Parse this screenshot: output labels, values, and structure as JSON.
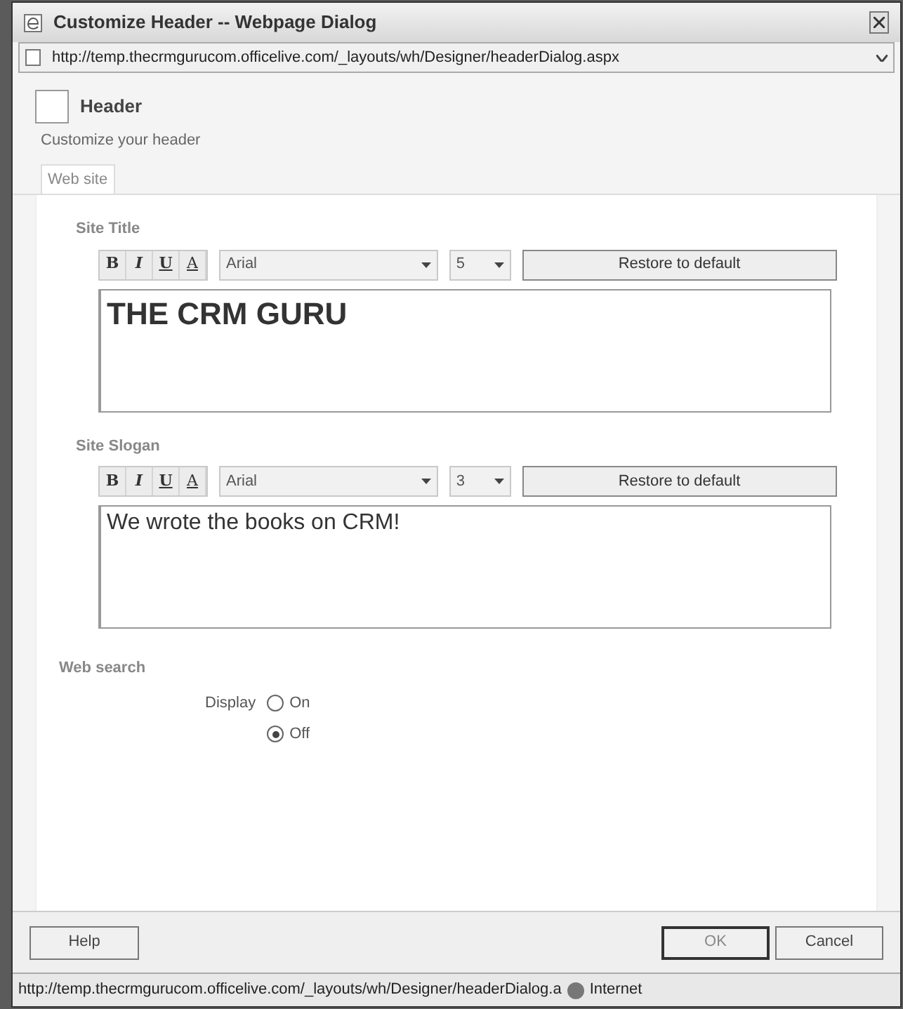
{
  "window": {
    "title": "Customize Header -- Webpage Dialog"
  },
  "address_bar": {
    "url": "http://temp.thecrmgurucom.officelive.com/_layouts/wh/Designer/headerDialog.aspx"
  },
  "header": {
    "title": "Header",
    "subtitle": "Customize your header"
  },
  "tabs": [
    {
      "label": "Web site",
      "selected": true
    }
  ],
  "sections": [
    {
      "label": "Site Title",
      "toolbar": [
        "B",
        "I",
        "U",
        "A"
      ],
      "font": "Arial",
      "size": "5",
      "restore_button": "Restore to default",
      "text": "THE CRM GURU",
      "kind": "title"
    },
    {
      "label": "Site Slogan",
      "toolbar": [
        "B",
        "I",
        "U",
        "A"
      ],
      "font": "Arial",
      "size": "3",
      "restore_button": "Restore to default",
      "text": "We wrote the books on CRM!",
      "kind": "slogan"
    }
  ],
  "web_search": {
    "label": "Web search",
    "field_label": "Display",
    "options": [
      {
        "label": "On",
        "selected": false
      },
      {
        "label": "Off",
        "selected": true
      }
    ]
  },
  "buttons": {
    "help": "Help",
    "ok": "OK",
    "cancel": "Cancel"
  },
  "status_bar": {
    "url": "http://temp.thecrmgurucom.officelive.com/_layouts/wh/Designer/headerDialog.a",
    "zone": "Internet"
  }
}
